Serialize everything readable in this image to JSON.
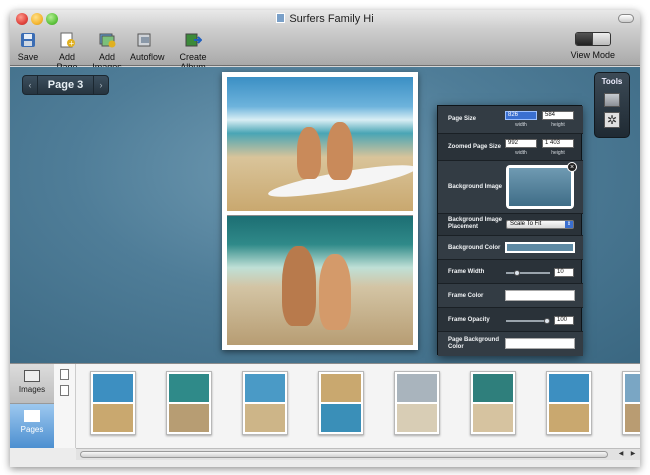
{
  "window": {
    "title": "Surfers Family Hi"
  },
  "toolbar": {
    "save": "Save",
    "add_page": "Add Page",
    "add_images": "Add Images",
    "autoflow": "Autoflow",
    "create_album": "Create Album",
    "view_mode": "View Mode"
  },
  "page_nav": {
    "label": "Page 3",
    "prev": "‹",
    "next": "›"
  },
  "tools": {
    "title": "Tools"
  },
  "inspector": {
    "page_size": {
      "label": "Page Size",
      "width": "826",
      "height": "584",
      "width_label": "width",
      "height_label": "height"
    },
    "zoomed_page_size": {
      "label": "Zoomed Page Size",
      "width": "992",
      "height": "1 403",
      "width_label": "width",
      "height_label": "height"
    },
    "background_image": {
      "label": "Background Image"
    },
    "background_image_placement": {
      "label": "Background Image Placement",
      "value": "Scale To Fit"
    },
    "background_color": {
      "label": "Background Color",
      "color": "#5e8aa4"
    },
    "frame_width": {
      "label": "Frame Width",
      "value": "10",
      "level": 0.2
    },
    "frame_color": {
      "label": "Frame Color",
      "color": "#ffffff"
    },
    "frame_opacity": {
      "label": "Frame Opacity",
      "value": "100",
      "level": 1.0
    },
    "page_background_color": {
      "label": "Page Background Color",
      "color": "#ffffff"
    }
  },
  "sidebar": {
    "images": "Images",
    "pages": "Pages"
  },
  "thumbnails": [
    {
      "c1": "#3d8fc1",
      "c2": "#c9a86f"
    },
    {
      "c1": "#2f8a89",
      "c2": "#b79d73"
    },
    {
      "c1": "#4a9ac6",
      "c2": "#cdb588"
    },
    {
      "c1": "#c9a86f",
      "c2": "#3a8fb8"
    },
    {
      "c1": "#a9b4bd",
      "c2": "#d8cdb5"
    },
    {
      "c1": "#2f7f7c",
      "c2": "#d6c3a0"
    },
    {
      "c1": "#3d8fc1",
      "c2": "#c9a86f"
    },
    {
      "c1": "#7aa6c4",
      "c2": "#b99c72"
    }
  ],
  "colors": {
    "accent": "#3a6fd0",
    "canvas": "#4f7d98"
  }
}
